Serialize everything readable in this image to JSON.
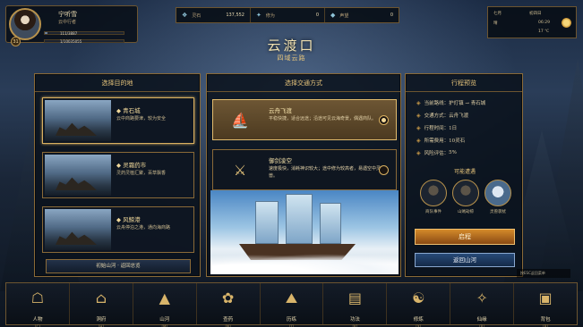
{
  "player": {
    "name": "宁听雪",
    "title": "云中行者",
    "level": "31",
    "hp_text": "111/3887",
    "xp_text": "1/10035055",
    "hp_fraction": 0.03,
    "xp_fraction": 0.0
  },
  "resources": [
    {
      "icon": "spirit-stone-icon",
      "glyph": "❖",
      "label": "灵石",
      "value": "137,552"
    },
    {
      "icon": "cultivation-icon",
      "glyph": "✦",
      "label": "修为",
      "value": "0"
    },
    {
      "icon": "reputation-icon",
      "glyph": "◆",
      "label": "声望",
      "value": "0"
    }
  ],
  "calendar": {
    "season": "七月",
    "day": "初四日",
    "time": "06:29",
    "temp": "17 ℃",
    "weather": "晴"
  },
  "location": {
    "title": "云渡口",
    "subtitle": "四域云路"
  },
  "destinations": {
    "header": "选择目的地",
    "items": [
      {
        "name": "◆ 青石城",
        "desc": "云中商路要津，较为安全"
      },
      {
        "name": "◆ 灵霜药市",
        "desc": "灵药灵植汇聚，百草飘香"
      },
      {
        "name": "◆ 风鲸港",
        "desc": "云舟停泊之港，通向海商路"
      }
    ],
    "back_label": "初始山河 · 返回总览"
  },
  "transport": {
    "header": "选择交通方式",
    "items": [
      {
        "name": "云舟飞渡",
        "desc": "平稳快捷，适合远途；沿途可见云海奇景，偶遇商队。",
        "selected": true
      },
      {
        "name": "御剑凌空",
        "desc": "速度极快，消耗神识较大；途中修为较高者，易遇空中灵兽。",
        "selected": false
      }
    ]
  },
  "plan": {
    "header": "行程预览",
    "rows": [
      {
        "label": "当前路线",
        "value": "护灯镇 → 青石城"
      },
      {
        "label": "交通方式",
        "value": "云舟飞渡"
      },
      {
        "label": "行程时间",
        "value": "1日"
      },
      {
        "label": "所需费用",
        "value": "10灵石"
      },
      {
        "label": "风险评估",
        "value": "5%"
      }
    ],
    "encounter_header": "可能遭遇",
    "encounters": [
      "商队事件",
      "山贼劫掠",
      "灵兽袭扰"
    ],
    "go_label": "启程",
    "back_label": "返回山河"
  },
  "tip": "按ESC返回菜单",
  "nav": [
    {
      "label": "人物",
      "key": "[C]",
      "icon": "character-icon",
      "glyph": "☖"
    },
    {
      "label": "洞府",
      "key": "[H]",
      "icon": "cave-home-icon",
      "glyph": "⌂"
    },
    {
      "label": "山河",
      "key": "[M]",
      "icon": "mountain-map-icon",
      "glyph": "▲"
    },
    {
      "label": "查药",
      "key": "[N]",
      "icon": "herb-icon",
      "glyph": "✿"
    },
    {
      "label": "历练",
      "key": "[T]",
      "icon": "training-icon",
      "glyph": "⛰"
    },
    {
      "label": "功法",
      "key": "[K]",
      "icon": "scripture-icon",
      "glyph": "▤"
    },
    {
      "label": "修炼",
      "key": "[X]",
      "icon": "meditation-icon",
      "glyph": "☯"
    },
    {
      "label": "仙缘",
      "key": "[R]",
      "icon": "destiny-icon",
      "glyph": "✧"
    },
    {
      "label": "背包",
      "key": "[B]",
      "icon": "bag-icon",
      "glyph": "▣"
    }
  ]
}
